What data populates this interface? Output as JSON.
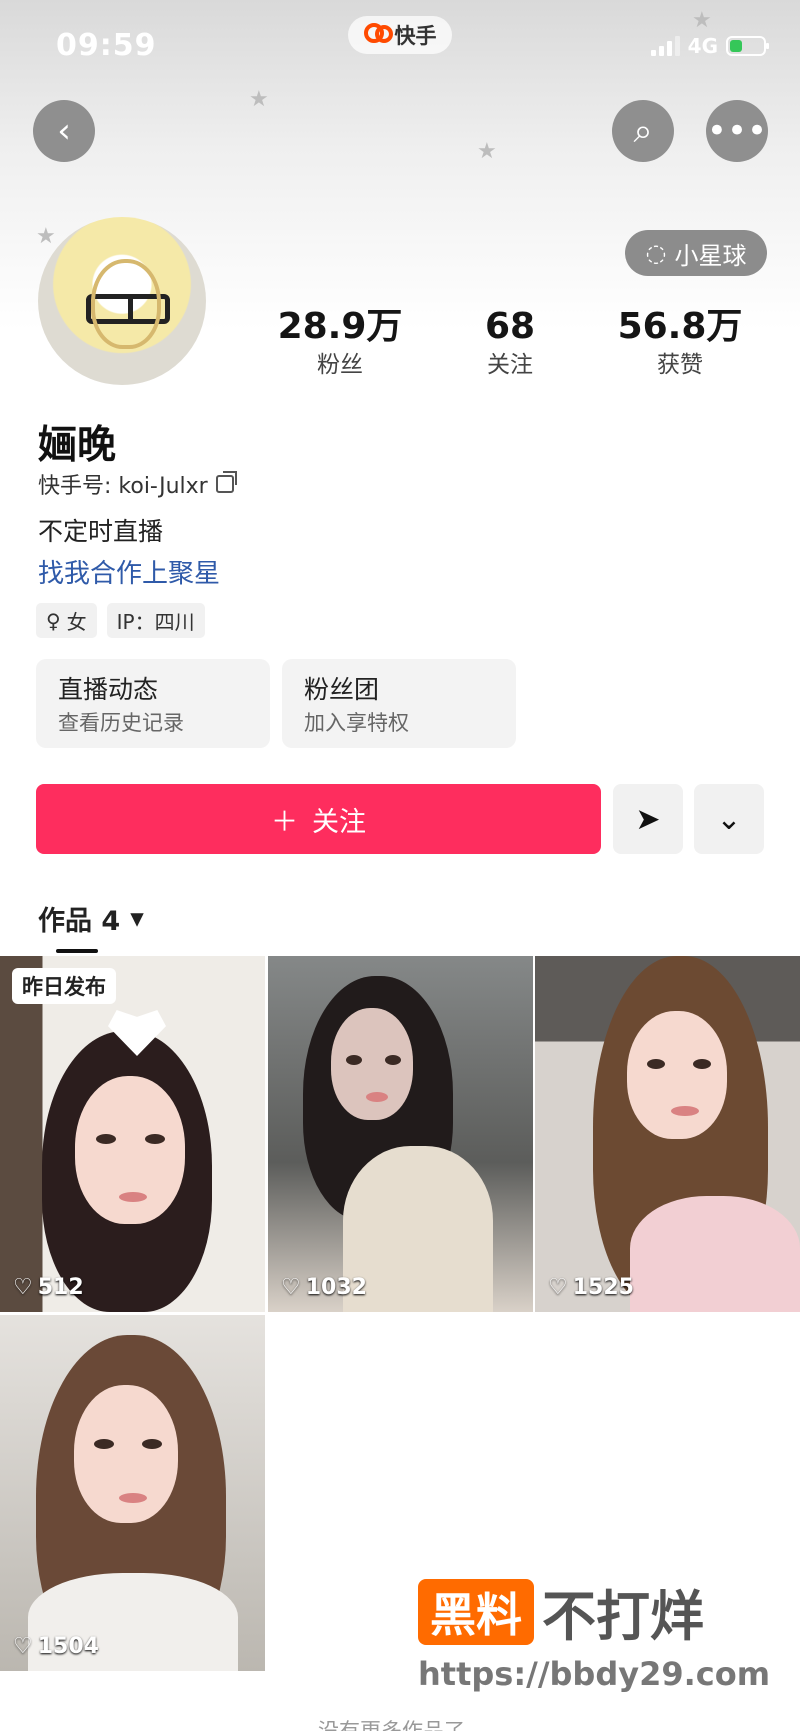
{
  "status": {
    "time": "09:59",
    "network": "4G",
    "app_name": "快手"
  },
  "profile": {
    "planet_label": "小星球",
    "name": "婳晚",
    "handle_label": "快手号: koi-Julxr",
    "bio": "不定时直播",
    "link": "找我合作上聚星",
    "stats": [
      {
        "value": "28.9万",
        "label": "粉丝"
      },
      {
        "value": "68",
        "label": "关注"
      },
      {
        "value": "56.8万",
        "label": "获赞"
      }
    ],
    "tags": [
      "女",
      "IP：四川"
    ],
    "cards": [
      {
        "title": "直播动态",
        "subtitle": "查看历史记录"
      },
      {
        "title": "粉丝团",
        "subtitle": "加入享特权"
      }
    ],
    "follow_label": "关注"
  },
  "works": {
    "tab_label": "作品 4",
    "items": [
      {
        "badge": "昨日发布",
        "likes": "512"
      },
      {
        "likes": "1032"
      },
      {
        "likes": "1525"
      },
      {
        "likes": "1504"
      }
    ],
    "end_text": "没有更多作品了"
  },
  "watermark": {
    "logo_text": "黑料",
    "title": "不打烊",
    "url": "https://bbdy29.com"
  },
  "icons": [
    "back-arrow",
    "search",
    "more-dots",
    "planet",
    "copy",
    "plus",
    "send",
    "chevron-down",
    "heart"
  ],
  "colors": {
    "follow_button": "#fe2d5e",
    "link": "#2f5aa9",
    "watermark_orange": "#ff6b00"
  }
}
